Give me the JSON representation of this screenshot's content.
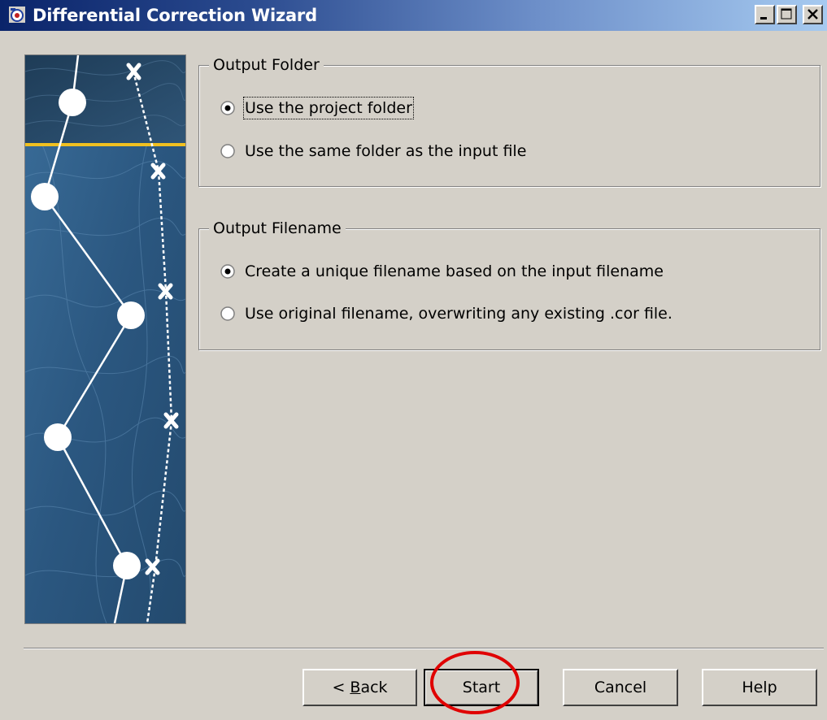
{
  "window": {
    "title": "Differential Correction Wizard",
    "controls": [
      "minimize-icon",
      "maximize-icon",
      "close-icon"
    ]
  },
  "output_folder": {
    "legend": "Output Folder",
    "options": [
      {
        "label": "Use the project folder",
        "selected": true
      },
      {
        "label": "Use the same folder as the input file",
        "selected": false
      }
    ]
  },
  "output_filename": {
    "legend": "Output Filename",
    "options": [
      {
        "label": "Create a unique filename based on the input filename",
        "selected": true
      },
      {
        "label": "Use original filename, overwriting any existing .cor file.",
        "selected": false
      }
    ]
  },
  "buttons": {
    "back_prefix": "< ",
    "back_mnemonic": "B",
    "back_rest": "ack",
    "start": "Start",
    "cancel": "Cancel",
    "help": "Help"
  },
  "colors": {
    "title_bar_start": "#0a246a",
    "title_bar_end": "#a6caf0",
    "dialog_bg": "#d4d0c8",
    "map_panel": "#2d5a83",
    "map_accent": "#f0c020",
    "annotation": "#e00000"
  }
}
